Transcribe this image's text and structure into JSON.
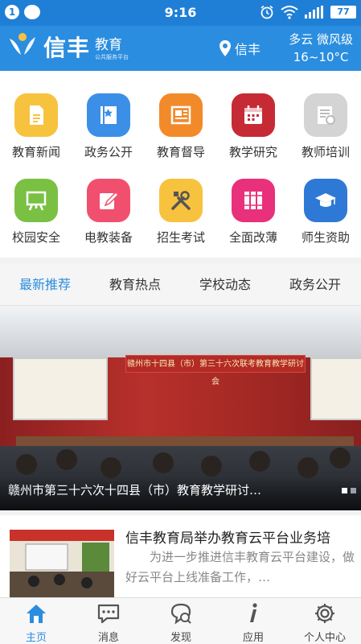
{
  "status_bar": {
    "time": "9:16",
    "notification_count": "1",
    "battery": "77"
  },
  "header": {
    "logo_name": "信丰",
    "logo_sub_main": "教育",
    "logo_sub_small": "公共服务平台",
    "location": "信丰",
    "weather_line1": "多云 微风级",
    "weather_line2": "16~10°C"
  },
  "grid": [
    {
      "label": "教育新闻",
      "color": "#f7c23d",
      "icon": "document-icon"
    },
    {
      "label": "政务公开",
      "color": "#3c8fe6",
      "icon": "book-icon"
    },
    {
      "label": "教育督导",
      "color": "#f28a2a",
      "icon": "newspaper-icon"
    },
    {
      "label": "教学研究",
      "color": "#c62b35",
      "icon": "calendar-icon"
    },
    {
      "label": "教师培训",
      "color": "#d4d4d4",
      "icon": "certificate-icon"
    },
    {
      "label": "校园安全",
      "color": "#7ac143",
      "icon": "easel-icon"
    },
    {
      "label": "电教装备",
      "color": "#f0506e",
      "icon": "edit-icon"
    },
    {
      "label": "招生考试",
      "color": "#f7c23d",
      "icon": "tools-icon"
    },
    {
      "label": "全面改薄",
      "color": "#e8317a",
      "icon": "books-icon"
    },
    {
      "label": "师生资助",
      "color": "#2e79d6",
      "icon": "graduation-cap-icon"
    }
  ],
  "tabs": [
    {
      "label": "最新推荐",
      "active": true
    },
    {
      "label": "教育热点",
      "active": false
    },
    {
      "label": "学校动态",
      "active": false
    },
    {
      "label": "政务公开",
      "active": false
    }
  ],
  "banner": {
    "caption": "赣州市第三十六次十四县（市）教育教学研讨…",
    "backdrop_title": "赣州市十四县（市）第三十六次联考教育教学研讨会",
    "slide_count": 2,
    "active_slide": 1
  },
  "news": [
    {
      "title": "信丰教育局举办教育云平台业务培",
      "summary": "为进一步推进信丰教育云平台建设，做好云平台上线准备工作，…"
    }
  ],
  "bottom_nav": [
    {
      "label": "主页",
      "icon": "home-icon",
      "active": true
    },
    {
      "label": "消息",
      "icon": "message-icon",
      "active": false
    },
    {
      "label": "发现",
      "icon": "discover-icon",
      "active": false
    },
    {
      "label": "应用",
      "icon": "info-icon",
      "active": false
    },
    {
      "label": "个人中心",
      "icon": "gear-icon",
      "active": false
    }
  ],
  "colors": {
    "status_bar": "#1f7fd6",
    "header": "#2a8de0",
    "accent": "#2a8de0"
  }
}
